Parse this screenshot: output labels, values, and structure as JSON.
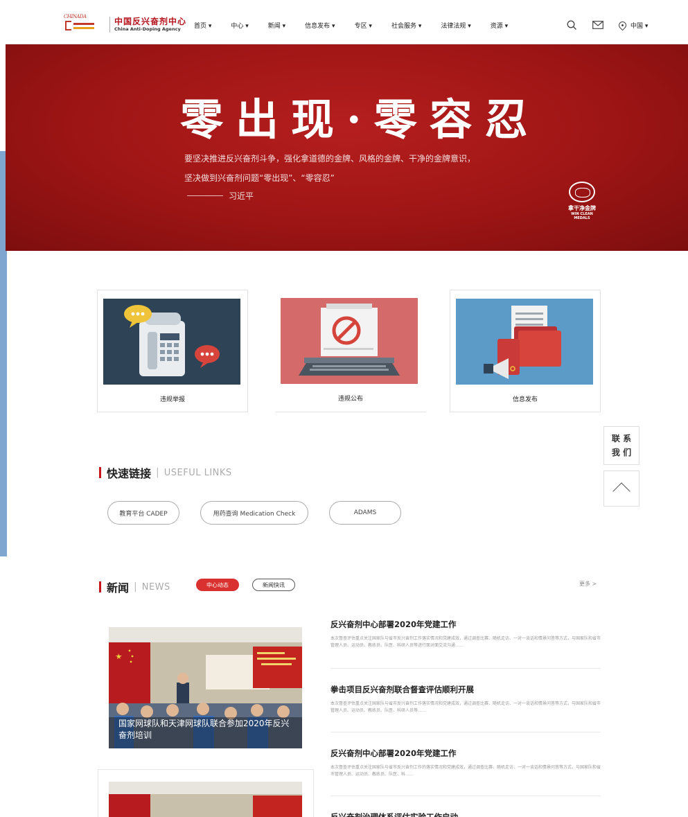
{
  "header": {
    "logo_mark": "CHINADA",
    "logo_cn": "中国反兴奋剂中心",
    "logo_en": "China Anti-Doping Agency",
    "nav": [
      "首页 ▾",
      "中心 ▾",
      "新闻 ▾",
      "信息发布 ▾",
      "专区 ▾",
      "社会服务 ▾",
      "法律法规 ▾",
      "资源 ▾"
    ],
    "region": "中国 ▾"
  },
  "banner": {
    "title": "零出现·零容忍",
    "line1": "要坚决推进反兴奋剂斗争，强化拿道德的金牌、风格的金牌、干净的金牌意识，",
    "line2": "坚决做到兴奋剂问题“零出现”、“零容忍”",
    "author": "习近平",
    "seal_cn": "拿干净金牌",
    "seal_en": "WIN CLEAN MEDALS"
  },
  "cards": [
    {
      "label": "违规举报"
    },
    {
      "label": "违规公布"
    },
    {
      "label": "信息发布"
    }
  ],
  "side": {
    "contact_line1": "联 系",
    "contact_line2": "我 们"
  },
  "links_section": {
    "title_cn": "快速链接",
    "sep": "|",
    "title_en": "USEFUL LINKS",
    "links": [
      "教育平台 CADEP",
      "用药查询 Medication Check",
      "ADAMS"
    ]
  },
  "news_section": {
    "title_cn": "新闻",
    "sep": "|",
    "title_en": "NEWS",
    "tab_active": "中心动态",
    "tab_other": "新闻快讯",
    "more": "更多 >",
    "photo_caption": "国家网球队和天津网球队联合参加2020年反兴奋剂培训",
    "items": [
      {
        "title": "反兴奋剂中心部署2020年党建工作",
        "desc": "本次督查评估重点关注国家队与省市反兴奋剂工作落实情况和党建成效，通过调查比赛、随机走访、一对一谈话和情景问答等方式，与国家队和省市管理人员、运动员、教练员、队医、科研人员等进行面对面交流沟通……"
      },
      {
        "title": "拳击项目反兴奋剂联合督查评估顺利开展",
        "desc": "本次督查评估重点关注国家队与省市反兴奋剂工作落实情况和党建成效，通过调查比赛、随机走访、一对一谈话和情景问答等方式，与国家队和省市管理人员、运动员、教练员、队医、科研人员等……"
      },
      {
        "title": "反兴奋剂中心部署2020年党建工作",
        "desc": "本次督查评估重点关注国家队与省市反兴奋剂工作的落实情况和党建成效，通过调查比赛、随机走访、一对一谈话和情景问答等方式，与国家队和省市管理人员、运动员、教练员、队医、科……"
      },
      {
        "title": "反兴奋剂治理体系评估实验工作启动"
      }
    ]
  },
  "colors": {
    "brand_red": "#c8161d",
    "banner_red": "#a8181a",
    "card1_bg": "#2e4356",
    "card2_bg": "#d46a6a",
    "card3_bg": "#5c9bc7"
  }
}
